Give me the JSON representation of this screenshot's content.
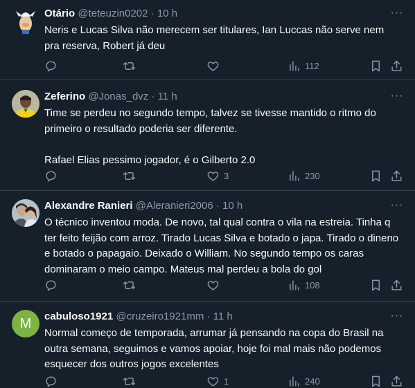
{
  "tweets": [
    {
      "name": "Otário",
      "handle": "@teteuzin0202",
      "dot": "·",
      "time": "10 h",
      "text": "Neris e Lucas Silva não merecem ser titulares, Ian Luccas não serve nem pra reserva, Robert já deu",
      "replies": "",
      "retweets": "",
      "likes": "",
      "views": "112",
      "avatar_icon": "cartoon-character-avatar"
    },
    {
      "name": "Zeferino",
      "handle": "@Jonas_dvz",
      "dot": "·",
      "time": "11 h",
      "text": "Time se perdeu no segundo tempo, talvez se tivesse mantido o ritmo do primeiro o resultado poderia ser diferente.\n\nRafael Elias pessimo jogador, é o Gilberto 2.0",
      "replies": "",
      "retweets": "",
      "likes": "3",
      "views": "230",
      "avatar_icon": "person-photo-avatar"
    },
    {
      "name": "Alexandre Ranieri",
      "handle": "@Aleranieri2006",
      "dot": "·",
      "time": "10 h",
      "text": "O técnico inventou moda. De novo, tal qual contra o vila na estreia. Tinha q ter feito feijão com arroz. Tirado Lucas Silva e botado o japa. Tirado o dineno e botado o papagaio. Deixado o William. No segundo tempo os caras dominaram o meio campo. Mateus mal perdeu a bola do gol",
      "replies": "",
      "retweets": "",
      "likes": "",
      "views": "108",
      "avatar_icon": "couple-photo-avatar"
    },
    {
      "name": "cabuloso1921",
      "handle": "@cruzeiro1921mm",
      "dot": "·",
      "time": "11 h",
      "text": "Normal começo de temporada, arrumar já pensando na copa do Brasil na outra semana, seguimos e vamos apoiar, hoje foi mal mais não podemos esquecer dos outros jogos excelentes",
      "replies": "",
      "retweets": "",
      "likes": "1",
      "views": "240",
      "avatar_letter": "M",
      "avatar_color": "#7cb342"
    }
  ],
  "more_glyph": "···",
  "colors": {
    "background": "#15202b",
    "text": "#f7f9f9",
    "secondary": "#8b98a5",
    "border": "#38444d"
  }
}
